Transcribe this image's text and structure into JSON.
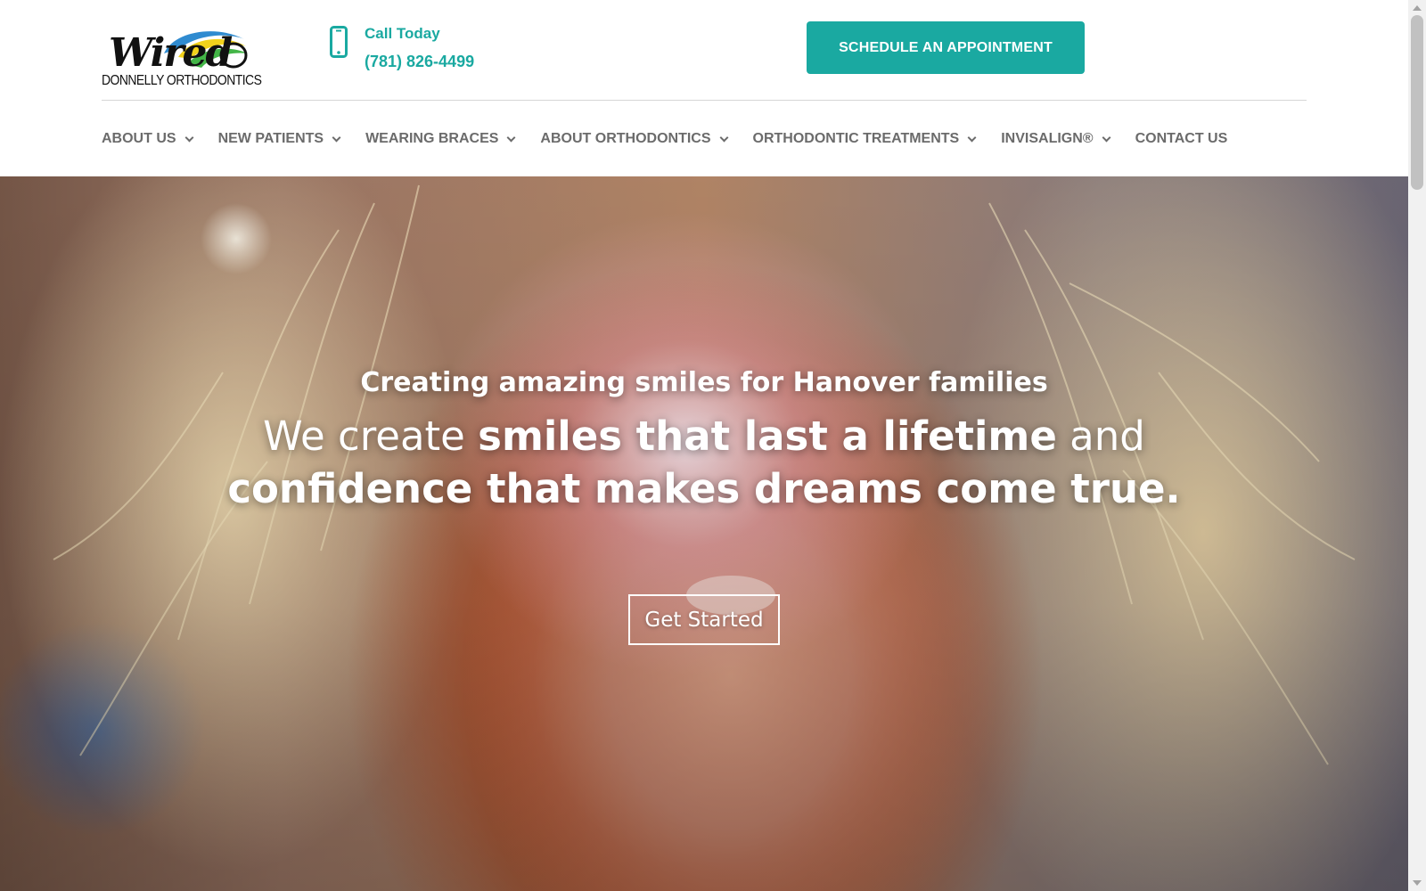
{
  "brand": {
    "logo_text": "Wired",
    "logo_subtitle": "DONNELLY ORTHODONTICS"
  },
  "contact": {
    "icon": "phone-icon",
    "label": "Call Today",
    "phone": "(781) 826-4499"
  },
  "cta": {
    "schedule_label": "SCHEDULE AN APPOINTMENT"
  },
  "nav": {
    "items": [
      {
        "label": "ABOUT US",
        "has_dropdown": true
      },
      {
        "label": "NEW PATIENTS",
        "has_dropdown": true
      },
      {
        "label": "WEARING BRACES",
        "has_dropdown": true
      },
      {
        "label": "ABOUT ORTHODONTICS",
        "has_dropdown": true
      },
      {
        "label": "ORTHODONTIC TREATMENTS",
        "has_dropdown": true
      },
      {
        "label": "INVISALIGN®",
        "has_dropdown": true
      },
      {
        "label": "CONTACT US",
        "has_dropdown": false
      }
    ]
  },
  "hero": {
    "eyebrow": "Creating amazing smiles for Hanover families",
    "headline": {
      "part1": "We create",
      "part2": "smiles that last a lifetime",
      "part3": "and",
      "part4": "confidence that makes dreams come true."
    },
    "button_label": "Get Started"
  },
  "colors": {
    "accent": "#1aa9a1",
    "nav_text": "#6b6b6b",
    "divider": "#d6d6d6"
  }
}
